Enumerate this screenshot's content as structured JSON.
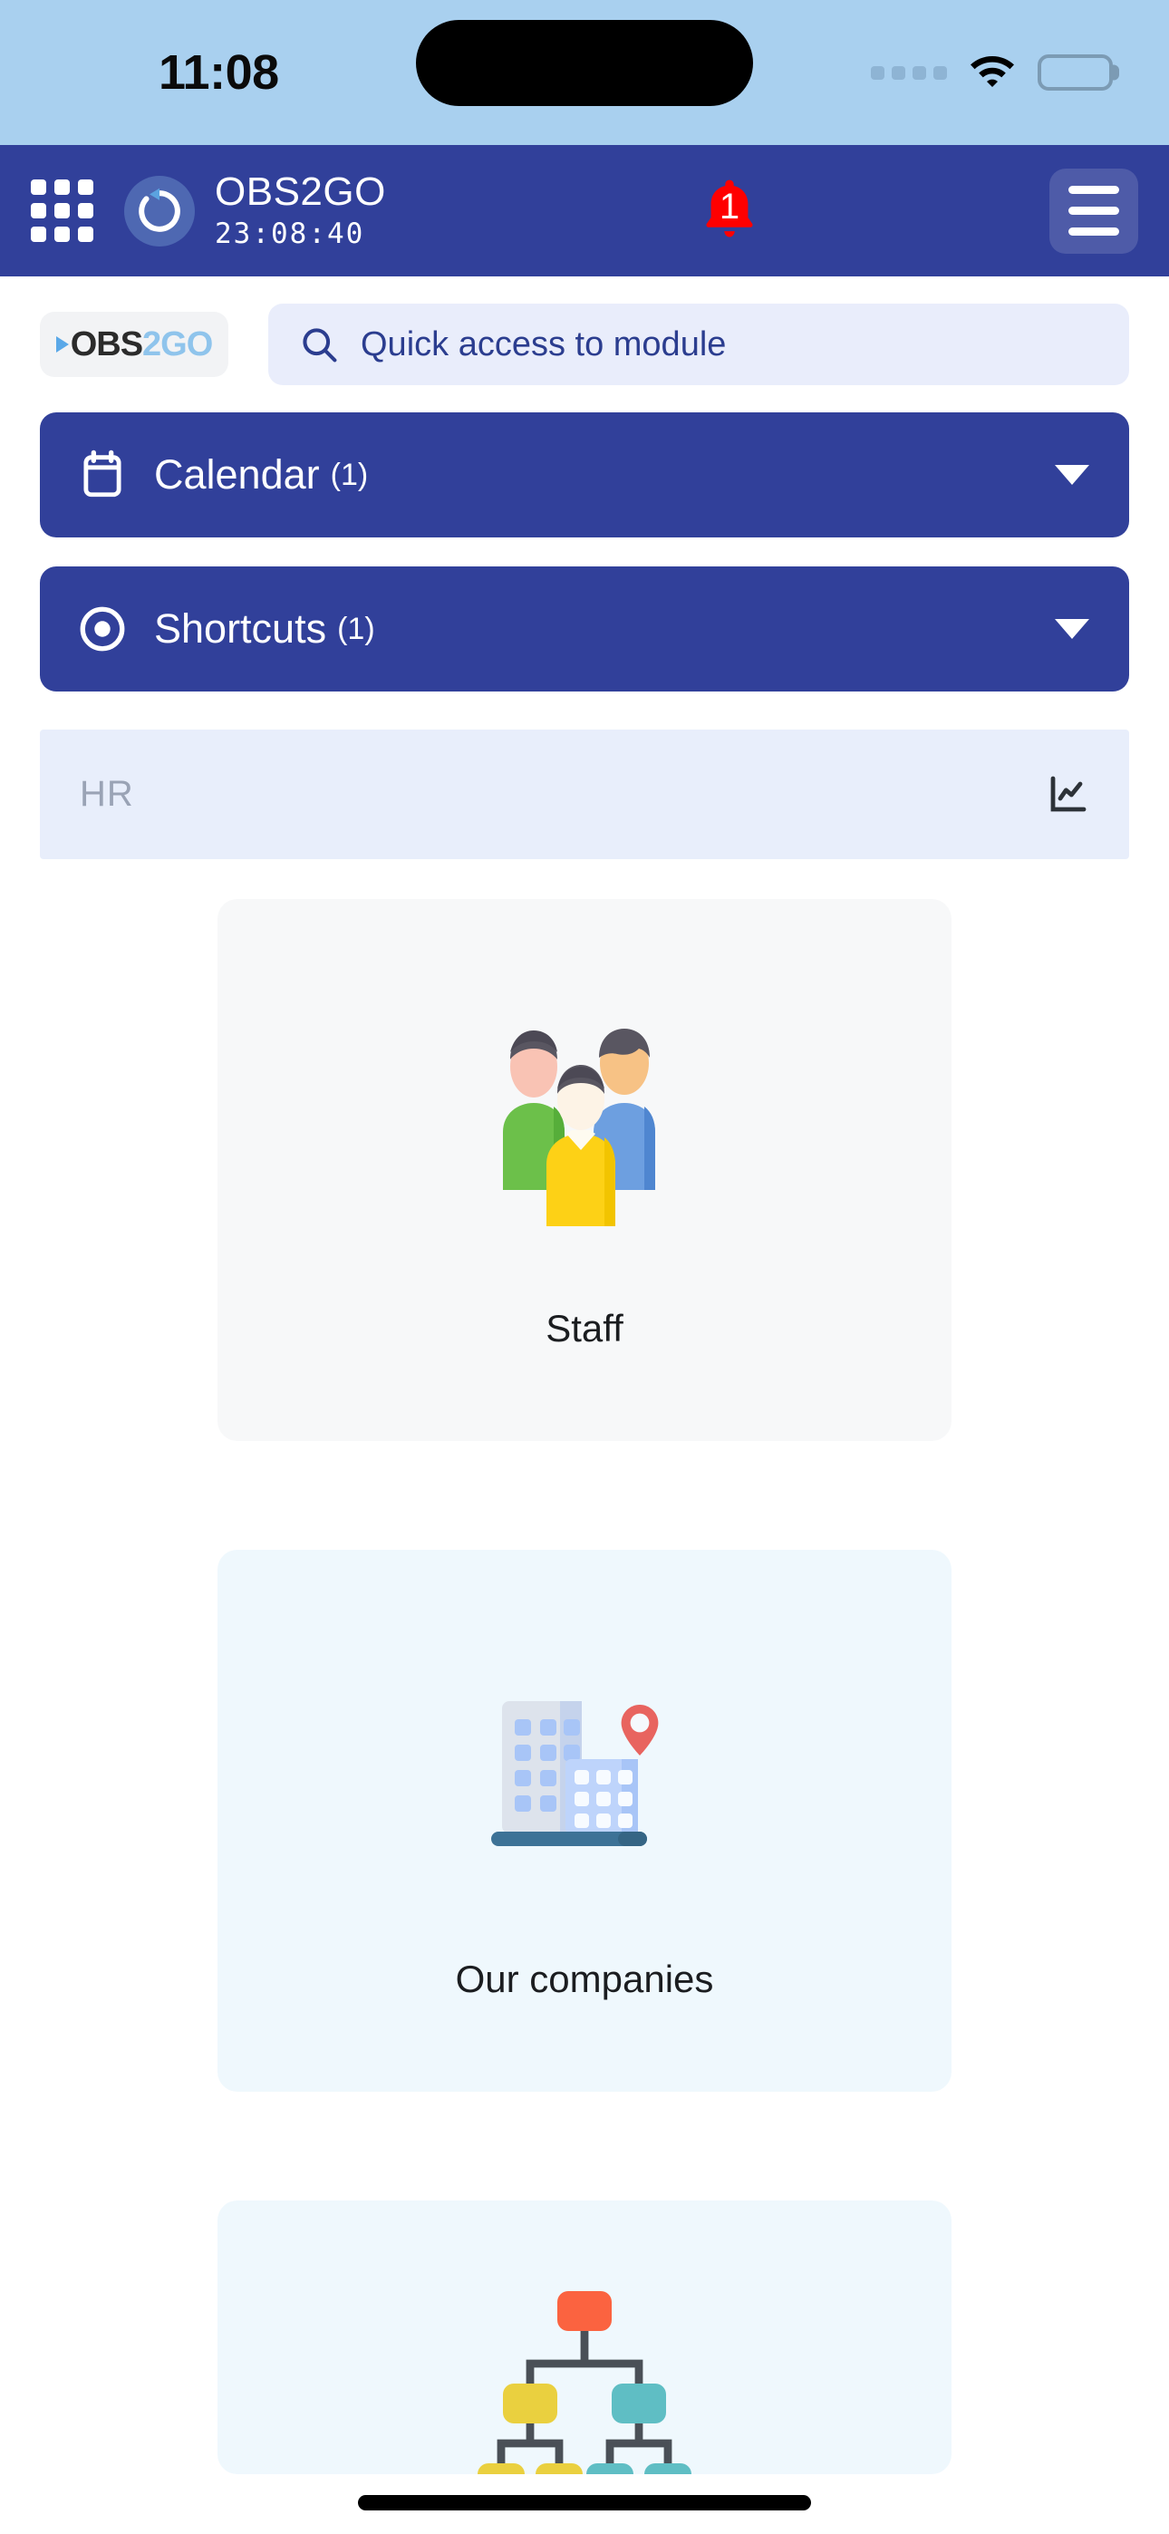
{
  "status_bar": {
    "time": "11:08",
    "signal_icon": "signal-dots-icon",
    "wifi_icon": "wifi-icon",
    "battery_icon": "battery-full-icon"
  },
  "app_header": {
    "grid_icon": "app-grid-icon",
    "logo_icon": "refresh-circle-icon",
    "title": "OBS2GO",
    "timer": "23:08:40",
    "notification_icon": "bell-icon",
    "notification_count": "1",
    "notification_color": "#ff0000",
    "menu_icon": "hamburger-menu-icon",
    "background_color": "#31409a"
  },
  "search": {
    "logo_prefix": "OBS",
    "logo_suffix": "2GO",
    "icon": "search-icon",
    "placeholder": "Quick access to module"
  },
  "panels": [
    {
      "icon": "calendar-icon",
      "label": "Calendar",
      "count": "(1)",
      "caret": "chevron-down-icon"
    },
    {
      "icon": "radio-target-icon",
      "label": "Shortcuts",
      "count": "(1)",
      "caret": "chevron-down-icon"
    }
  ],
  "section": {
    "title": "HR",
    "chart_icon": "line-chart-icon",
    "cards": [
      {
        "label": "Staff",
        "art": "people-group-illustration",
        "theme": "staff"
      },
      {
        "label": "Our companies",
        "art": "office-buildings-illustration",
        "theme": "light"
      },
      {
        "label": "",
        "art": "org-chart-illustration",
        "theme": "light"
      }
    ]
  },
  "colors": {
    "status_bar_bg": "#a9d0ef",
    "brand_blue": "#31409a",
    "search_bg": "#e9edfb",
    "section_head_bg": "#e8eefb",
    "card_light_bg": "#eff8fd"
  }
}
